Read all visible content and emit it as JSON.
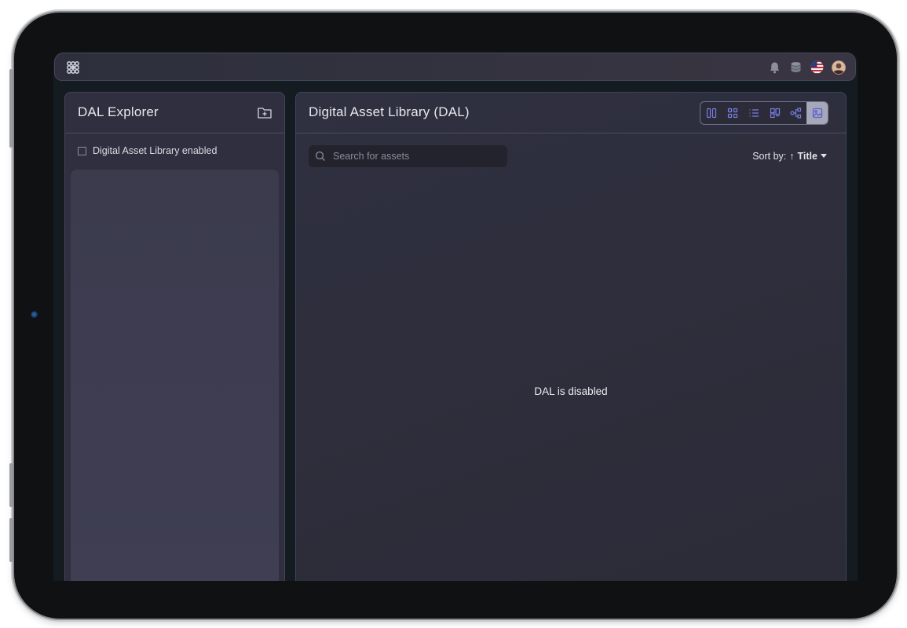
{
  "topbar": {
    "logo": "app-logo-icon",
    "icons": [
      "bell-icon",
      "database-icon",
      "us-flag-icon",
      "user-avatar"
    ]
  },
  "explorer": {
    "title": "DAL Explorer",
    "new_folder_icon": "folder-plus-icon",
    "checkbox_label": "Digital Asset Library enabled",
    "checkbox_checked": false
  },
  "library": {
    "title": "Digital Asset Library (DAL)",
    "view_modes": [
      "columns-view-icon",
      "grid-view-icon",
      "list-view-icon",
      "board-view-icon",
      "tree-view-icon",
      "gallery-view-icon"
    ],
    "active_view": "gallery-view-icon",
    "search_placeholder": "Search for assets",
    "sort_label": "Sort by:",
    "sort_direction": "↑",
    "sort_value": "Title",
    "empty_message": "DAL is disabled"
  },
  "colors": {
    "accent": "#7b7fe0",
    "panel": "#2f2f3f",
    "topbar": "#2d2f3d"
  }
}
